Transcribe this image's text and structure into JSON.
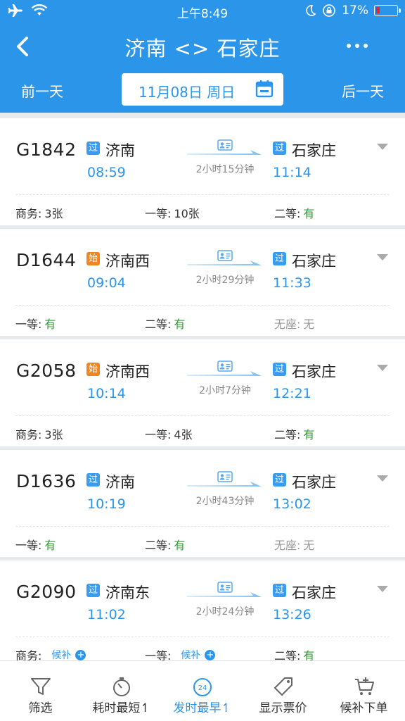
{
  "status_bar": {
    "time": "上午8:49",
    "battery": "17%"
  },
  "nav": {
    "title": "济南 <> 石家庄"
  },
  "date_bar": {
    "prev_label": "前一天",
    "date": "11月08日 周日",
    "next_label": "后一天"
  },
  "trains": [
    {
      "no": "G1842",
      "from_badge": "过",
      "from": "济南",
      "dep": "08:59",
      "to_badge": "过",
      "to": "石家庄",
      "arr": "11:14",
      "duration": "2小时15分钟",
      "seats": [
        {
          "cls": "商务:",
          "val": "3张",
          "style": "plain"
        },
        {
          "cls": "一等:",
          "val": "10张",
          "style": "plain"
        },
        {
          "cls": "二等:",
          "val": "有",
          "style": "green"
        }
      ]
    },
    {
      "no": "D1644",
      "from_badge": "始",
      "from": "济南西",
      "dep": "09:04",
      "to_badge": "过",
      "to": "石家庄",
      "arr": "11:33",
      "duration": "2小时29分钟",
      "seats": [
        {
          "cls": "一等:",
          "val": "有",
          "style": "green"
        },
        {
          "cls": "二等:",
          "val": "有",
          "style": "green"
        },
        {
          "cls": "无座:",
          "val": "无",
          "style": "gray"
        }
      ]
    },
    {
      "no": "G2058",
      "from_badge": "始",
      "from": "济南西",
      "dep": "10:14",
      "to_badge": "过",
      "to": "石家庄",
      "arr": "12:21",
      "duration": "2小时7分钟",
      "seats": [
        {
          "cls": "商务:",
          "val": "3张",
          "style": "plain"
        },
        {
          "cls": "一等:",
          "val": "4张",
          "style": "plain"
        },
        {
          "cls": "二等:",
          "val": "有",
          "style": "green"
        }
      ]
    },
    {
      "no": "D1636",
      "from_badge": "过",
      "from": "济南",
      "dep": "10:19",
      "to_badge": "过",
      "to": "石家庄",
      "arr": "13:02",
      "duration": "2小时43分钟",
      "seats": [
        {
          "cls": "一等:",
          "val": "有",
          "style": "green"
        },
        {
          "cls": "二等:",
          "val": "有",
          "style": "green"
        },
        {
          "cls": "无座:",
          "val": "无",
          "style": "gray"
        }
      ]
    },
    {
      "no": "G2090",
      "from_badge": "过",
      "from": "济南东",
      "dep": "11:02",
      "to_badge": "过",
      "to": "石家庄",
      "arr": "13:26",
      "duration": "2小时24分钟",
      "seats": [
        {
          "cls": "商务:",
          "val": "候补",
          "style": "waitlist"
        },
        {
          "cls": "一等:",
          "val": "候补",
          "style": "waitlist"
        },
        {
          "cls": "二等:",
          "val": "有",
          "style": "green"
        }
      ]
    }
  ],
  "tabbar": [
    {
      "label": "筛选",
      "icon": "filter-icon",
      "active": false
    },
    {
      "label": "耗时最短↿",
      "icon": "stopwatch-icon",
      "active": false
    },
    {
      "label": "发时最早↿",
      "icon": "clock-24-icon",
      "active": true
    },
    {
      "label": "显示票价",
      "icon": "price-tag-icon",
      "active": false
    },
    {
      "label": "候补下单",
      "icon": "cart-plus-icon",
      "active": false
    }
  ],
  "colors": {
    "primary": "#2b95ea",
    "green": "#2f9e34",
    "orange": "#f2851f"
  }
}
